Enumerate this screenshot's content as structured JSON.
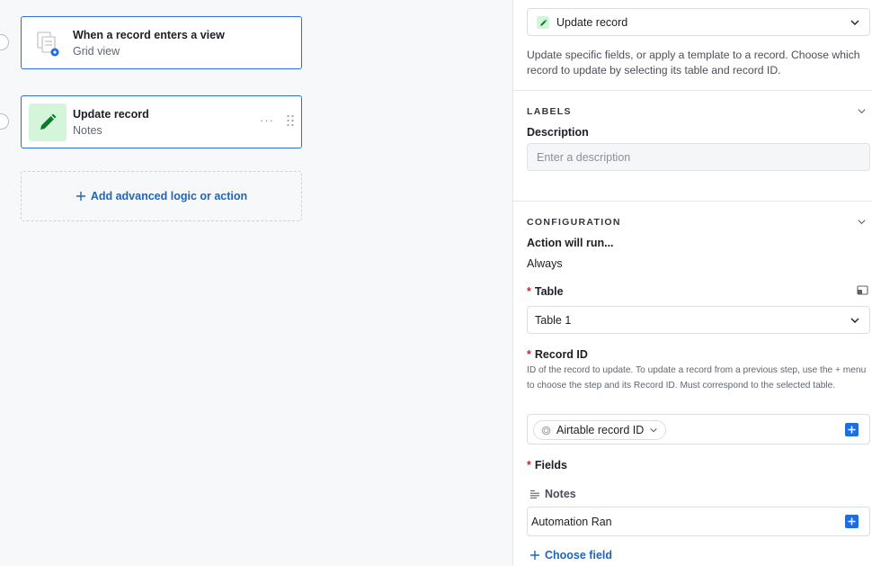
{
  "canvas": {
    "trigger": {
      "title": "When a record enters a view",
      "subtitle": "Grid view",
      "icon": "view-trigger-icon"
    },
    "action": {
      "title": "Update record",
      "subtitle": "Notes",
      "icon": "pencil-icon",
      "more": "···"
    },
    "add_action_label": "Add advanced logic or action"
  },
  "panel": {
    "action_type": {
      "value": "Update record",
      "icon": "pencil-icon"
    },
    "description": "Update specific fields, or apply a template to a record. Choose which record to update by selecting its table and record ID.",
    "labels_section": {
      "heading": "LABELS",
      "description_label": "Description",
      "description_placeholder": "Enter a description"
    },
    "configuration": {
      "heading": "CONFIGURATION",
      "run_label": "Action will run...",
      "run_value": "Always",
      "table_label": "Table",
      "table_value": "Table 1",
      "record_id_label": "Record ID",
      "record_id_help": "ID of the record to update. To update a record from a previous step, use the + menu to choose the step and its Record ID. Must correspond to the selected table.",
      "record_id_token": "Airtable record ID",
      "fields_label": "Fields",
      "field_name": "Notes",
      "field_value": "Automation Ran",
      "choose_field_label": "Choose field"
    }
  },
  "colors": {
    "accent": "#1f6ee0",
    "link": "#1d66b9",
    "card_border": "#2d6fd1",
    "required": "#c5282a",
    "action_icon_bg": "#d4f5d9",
    "action_icon_fg": "#0d7a2a"
  }
}
